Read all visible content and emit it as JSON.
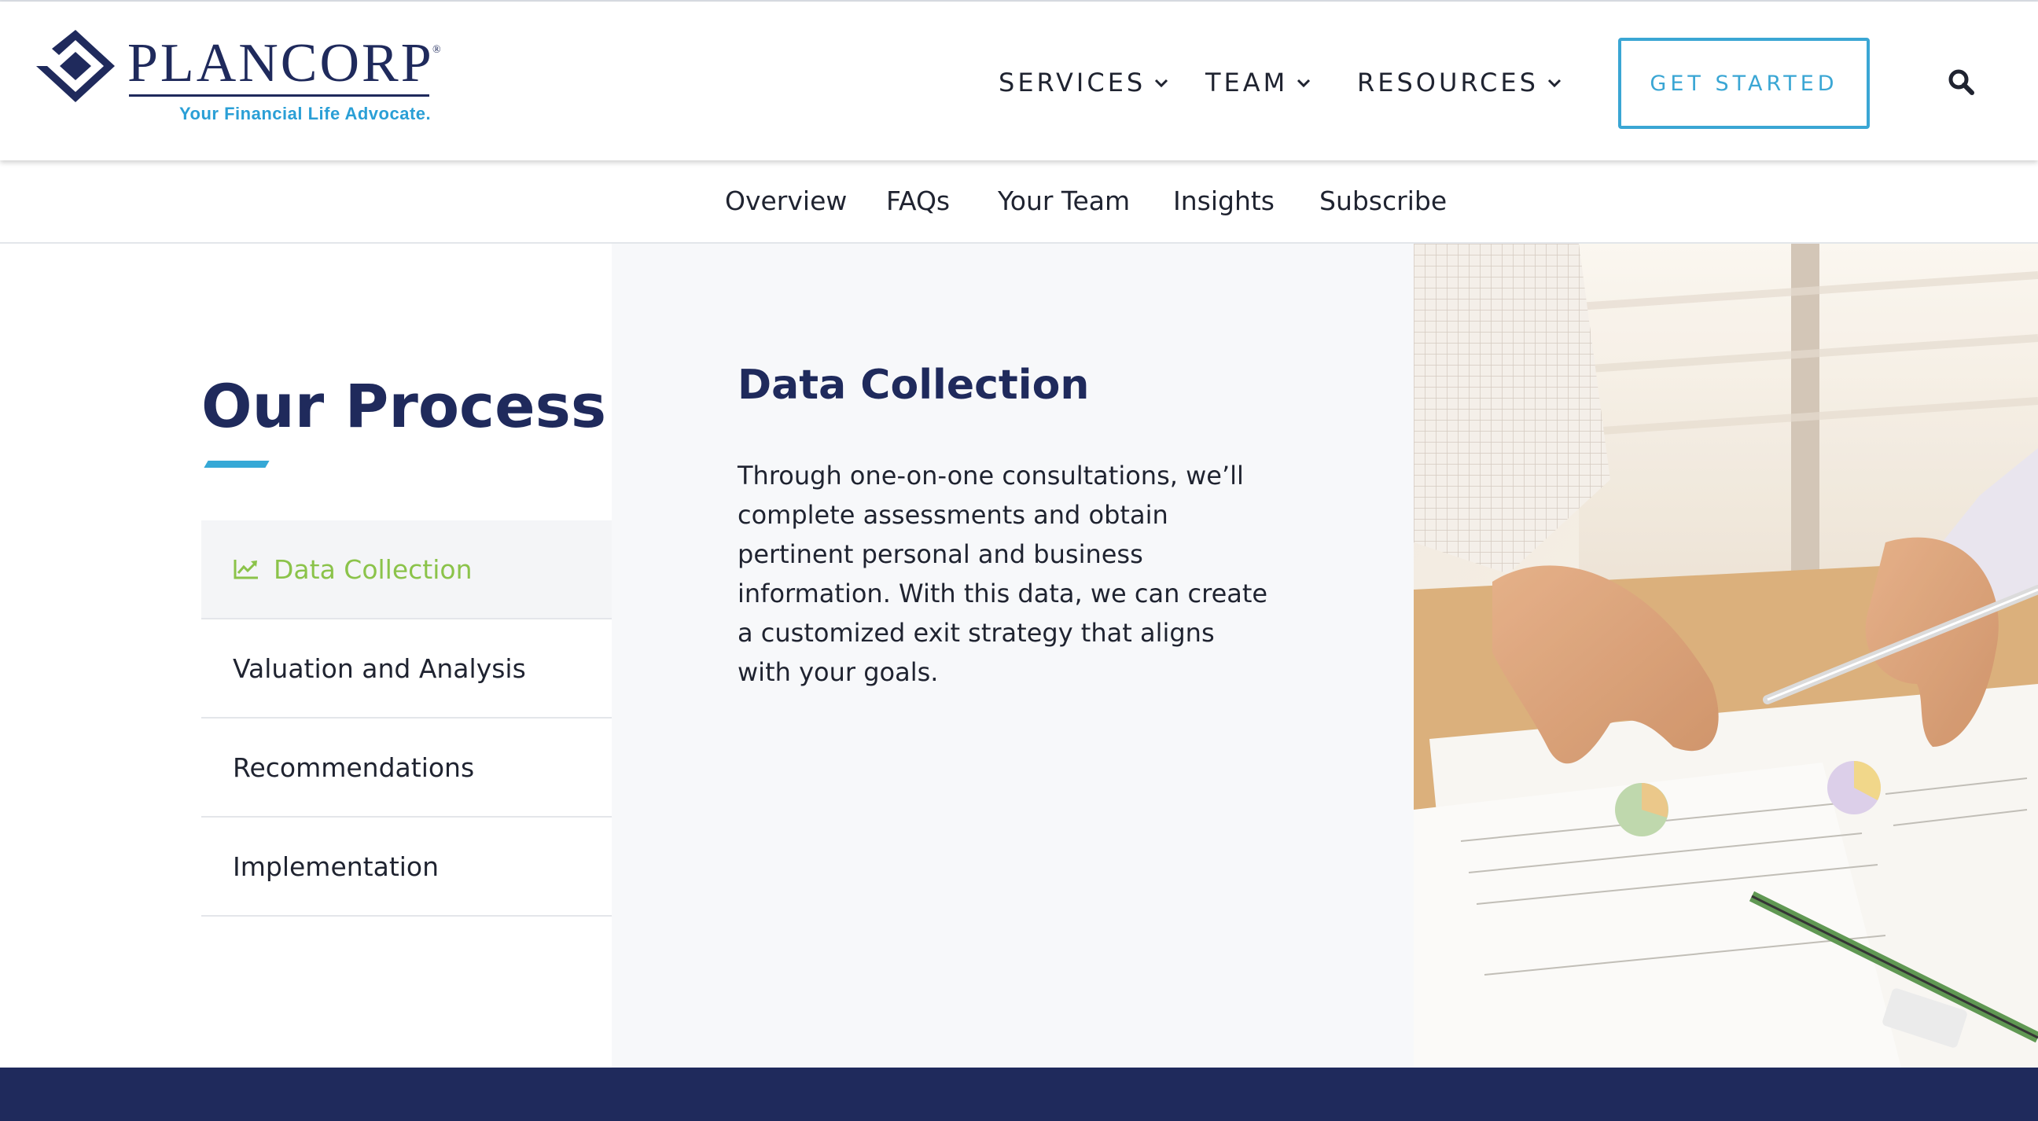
{
  "header": {
    "logo": {
      "wordmark": "PLANCORP",
      "registered": "®",
      "tagline": "Your Financial Life Advocate."
    },
    "nav": [
      {
        "label": "SERVICES",
        "icon": "chevron-down-icon"
      },
      {
        "label": "TEAM",
        "icon": "chevron-down-icon"
      },
      {
        "label": "RESOURCES",
        "icon": "chevron-down-icon"
      }
    ],
    "cta_label": "GET STARTED",
    "search_icon": "search-icon"
  },
  "subnav": [
    "Overview",
    "FAQs",
    "Your Team",
    "Insights",
    "Subscribe"
  ],
  "process": {
    "title": "Our Process",
    "tabs": [
      {
        "label": "Data Collection",
        "active": true,
        "icon": "line-chart-icon"
      },
      {
        "label": "Valuation and Analysis",
        "active": false
      },
      {
        "label": "Recommendations",
        "active": false
      },
      {
        "label": "Implementation",
        "active": false
      }
    ],
    "content": {
      "heading": "Data Collection",
      "body": "Through one-on-one consultations, we’ll complete assessments and obtain pertinent personal and business information. With this data, we can create a customized exit strategy that aligns with your goals."
    }
  },
  "colors": {
    "navy": "#1f2a5c",
    "accent_blue": "#3aa6d4",
    "active_green": "#8bc34a",
    "panel_gray": "#f7f8fa"
  }
}
